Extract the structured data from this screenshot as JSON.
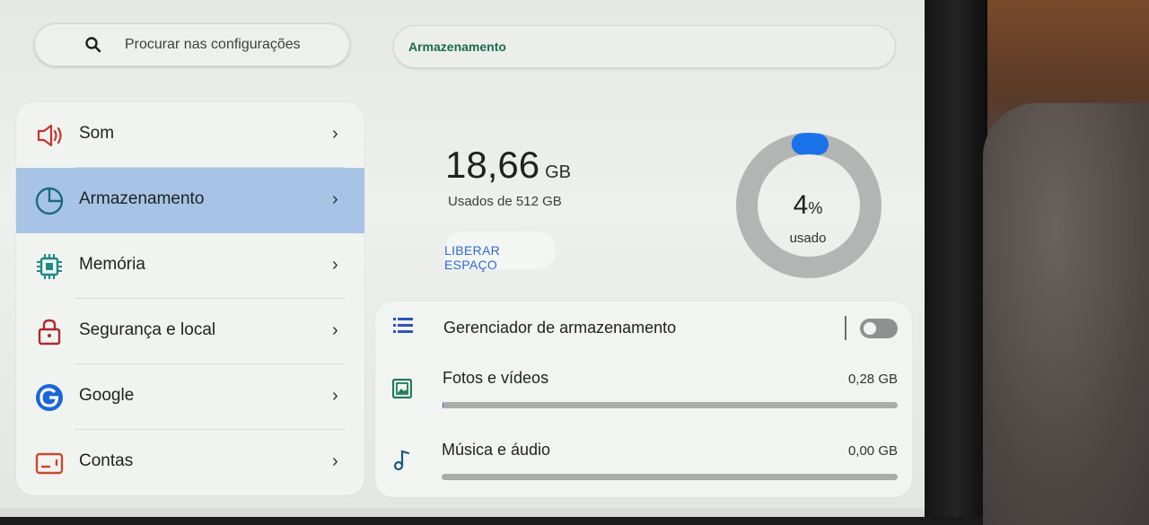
{
  "search": {
    "placeholder": "Procurar nas configurações"
  },
  "breadcrumb": {
    "title": "Armazenamento"
  },
  "sidebar": {
    "items": [
      {
        "label": "Som",
        "icon": "speaker-icon",
        "active": false
      },
      {
        "label": "Armazenamento",
        "icon": "storage-pie-icon",
        "active": true
      },
      {
        "label": "Memória",
        "icon": "chip-icon",
        "active": false
      },
      {
        "label": "Segurança e local",
        "icon": "lock-icon",
        "active": false
      },
      {
        "label": "Google",
        "icon": "google-icon",
        "active": false
      },
      {
        "label": "Contas",
        "icon": "accounts-icon",
        "active": false
      }
    ]
  },
  "storage": {
    "used_value": "18,66",
    "used_unit": "GB",
    "used_of": "Usados de 512 GB",
    "free_button": "LIBERAR ESPAÇO",
    "percent_value": "4",
    "percent_sign": "%",
    "percent_label": "usado",
    "percent_fraction": 0.04
  },
  "manager": {
    "label": "Gerenciador de armazenamento",
    "enabled": false
  },
  "categories": [
    {
      "label": "Fotos e vídeos",
      "value": "0,28 GB",
      "fraction": 0.0005
    },
    {
      "label": "Música e áudio",
      "value": "0,00 GB",
      "fraction": 0
    }
  ],
  "colors": {
    "accent_blue": "#2a6bd0",
    "active_item": "#a7c4e6",
    "crumb_green": "#1c6b4a",
    "ring_track": "#b2b5b3",
    "ring_fill": "#1a73e8"
  }
}
